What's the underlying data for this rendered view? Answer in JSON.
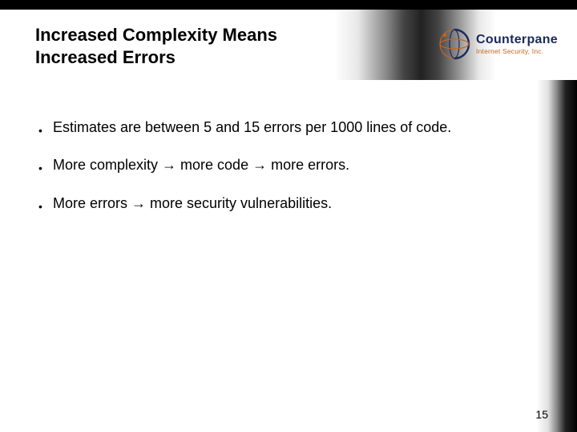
{
  "slide": {
    "title": "Increased Complexity Means Increased Errors",
    "bullets": [
      "Estimates are between 5 and 15 errors per 1000 lines of code.",
      "More complexity → more code → more errors.",
      "More errors → more security vulnerabilities."
    ],
    "page_number": "15"
  },
  "logo": {
    "name": "Counterpane",
    "tagline": "Internet Security, Inc."
  }
}
